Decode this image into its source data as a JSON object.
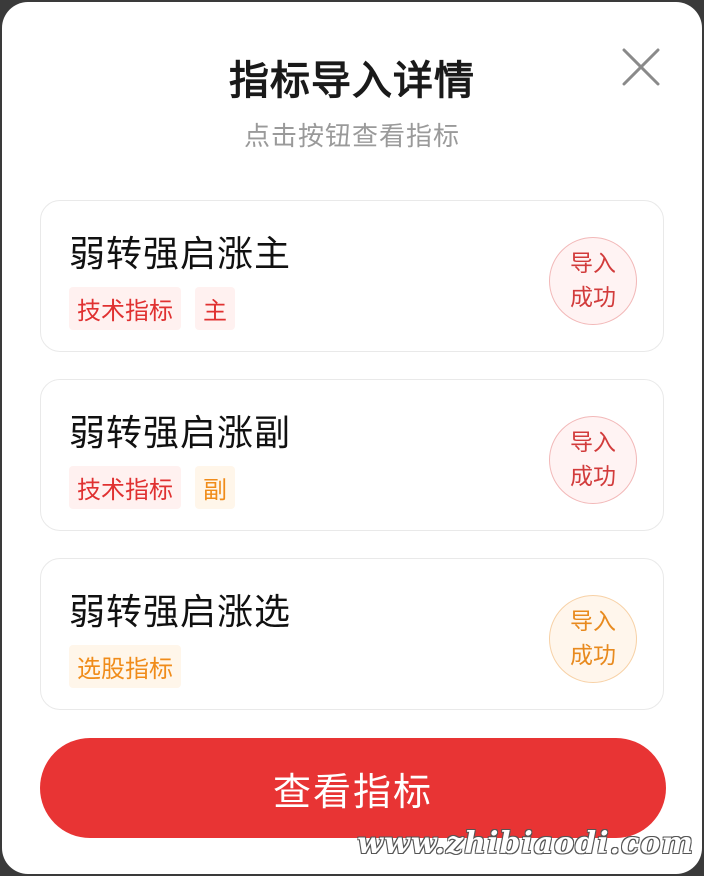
{
  "dialog": {
    "title": "指标导入详情",
    "subtitle": "点击按钮查看指标",
    "close_icon": "close-icon"
  },
  "items": [
    {
      "name": "弱转强启涨主",
      "tags": [
        "技术指标",
        "主"
      ],
      "tag_color": "#e03131",
      "status_line1": "导入",
      "status_line2": "成功",
      "status_color": "#d23b3b"
    },
    {
      "name": "弱转强启涨副",
      "tags": [
        "技术指标",
        "副"
      ],
      "tag_colors": [
        "#e03131",
        "#f08c1a"
      ],
      "status_line1": "导入",
      "status_line2": "成功",
      "status_color": "#d23b3b"
    },
    {
      "name": "弱转强启涨选",
      "tags": [
        "选股指标"
      ],
      "tag_color": "#f08c1a",
      "status_line1": "导入",
      "status_line2": "成功",
      "status_color": "#e88a1e"
    }
  ],
  "primary_button": {
    "label": "查看指标",
    "color": "#e83434"
  },
  "watermark": "www.zhibiaodi.com"
}
